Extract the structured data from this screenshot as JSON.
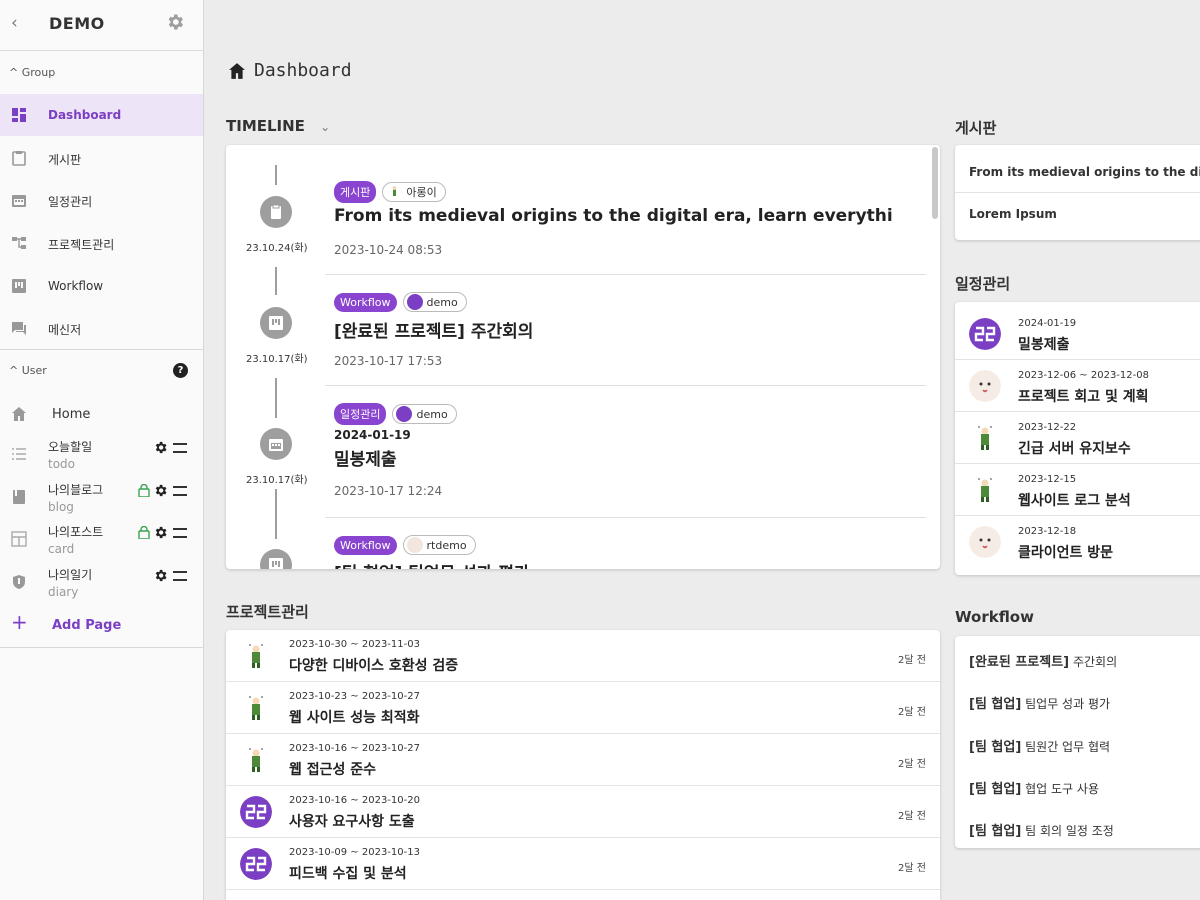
{
  "sidebar": {
    "title": "DEMO",
    "group_label": "Group",
    "group_items": [
      {
        "label": "Dashboard",
        "icon": "dashboard-icon",
        "active": true
      },
      {
        "label": "게시판",
        "icon": "clipboard-icon"
      },
      {
        "label": "일정관리",
        "icon": "calendar-icon"
      },
      {
        "label": "프로젝트관리",
        "icon": "tree-icon"
      },
      {
        "label": "Workflow",
        "icon": "kanban-icon"
      },
      {
        "label": "메신저",
        "icon": "chat-icon"
      }
    ],
    "user_label": "User",
    "help_glyph": "?",
    "home_label": "Home",
    "pages": [
      {
        "title": "오늘할일",
        "type": "todo",
        "locked": false
      },
      {
        "title": "나의블로그",
        "type": "blog",
        "locked": true
      },
      {
        "title": "나의포스트",
        "type": "card",
        "locked": true
      },
      {
        "title": "나의일기",
        "type": "diary",
        "locked": false
      }
    ],
    "add_page_label": "Add Page",
    "add_glyph": "+"
  },
  "main": {
    "page_title": "Dashboard",
    "timeline_title": "TIMELINE",
    "timeline": [
      {
        "date": "23.10.24(화)",
        "tag": "게시판",
        "user": "아롱이",
        "title": "From its medieval origins to the digital era, learn everythi",
        "sub": "",
        "time": "2023-10-24 08:53",
        "icon": "clipboard-icon"
      },
      {
        "date": "23.10.17(화)",
        "tag": "Workflow",
        "user": "demo",
        "title": "[완료된 프로젝트] 주간회의",
        "sub": "",
        "time": "2023-10-17 17:53",
        "icon": "kanban-icon"
      },
      {
        "date": "23.10.17(화)",
        "tag": "일정관리",
        "user": "demo",
        "title": "밀봉제출",
        "sub": "2024-01-19",
        "time": "2023-10-17 12:24",
        "icon": "calendar-icon"
      },
      {
        "date": "",
        "tag": "Workflow",
        "user": "rtdemo",
        "title": "[팀 협업] 팀업무 성과 평가",
        "sub": "",
        "time": "",
        "icon": "kanban-icon"
      }
    ],
    "project_title": "프로젝트관리",
    "projects": [
      {
        "dates": "2023-10-30 ~ 2023-11-03",
        "name": "다양한 디바이스 호환성 검증",
        "ago": "2달 전",
        "avatar": "character"
      },
      {
        "dates": "2023-10-23 ~ 2023-10-27",
        "name": "웹 사이트 성능 최적화",
        "ago": "2달 전",
        "avatar": "character"
      },
      {
        "dates": "2023-10-16 ~ 2023-10-27",
        "name": "웹 접근성 준수",
        "ago": "2달 전",
        "avatar": "character"
      },
      {
        "dates": "2023-10-16 ~ 2023-10-20",
        "name": "사용자 요구사항 도출",
        "ago": "2달 전",
        "avatar": "logo"
      },
      {
        "dates": "2023-10-09 ~ 2023-10-13",
        "name": "피드백 수집 및 분석",
        "ago": "2달 전",
        "avatar": "logo"
      }
    ]
  },
  "right": {
    "board_title": "게시판",
    "board": [
      "From its medieval origins to the digita",
      "Lorem Ipsum"
    ],
    "schedule_title": "일정관리",
    "schedule": [
      {
        "date": "2024-01-19",
        "name": "밀봉제출",
        "avatar": "logo"
      },
      {
        "date": "2023-12-06 ~ 2023-12-08",
        "name": "프로젝트 회고 및 계획",
        "avatar": "face"
      },
      {
        "date": "2023-12-22",
        "name": "긴급 서버 유지보수",
        "avatar": "character"
      },
      {
        "date": "2023-12-15",
        "name": "웹사이트 로그 분석",
        "avatar": "character"
      },
      {
        "date": "2023-12-18",
        "name": "클라이언트 방문",
        "avatar": "face"
      }
    ],
    "workflow_title": "Workflow",
    "workflow": [
      {
        "prefix": "[완료된 프로젝트]",
        "text": " 주간회의"
      },
      {
        "prefix": "[팀 협업]",
        "text": " 팀업무 성과 평가"
      },
      {
        "prefix": "[팀 협업]",
        "text": " 팀원간 업무 협력"
      },
      {
        "prefix": "[팀 협업]",
        "text": " 협업 도구 사용"
      },
      {
        "prefix": "[팀 협업]",
        "text": " 팀 회의 일정 조정"
      }
    ]
  },
  "colors": {
    "accent": "#7b3fc4",
    "tag": "#8a45d0",
    "active_bg": "#ede4f7"
  }
}
